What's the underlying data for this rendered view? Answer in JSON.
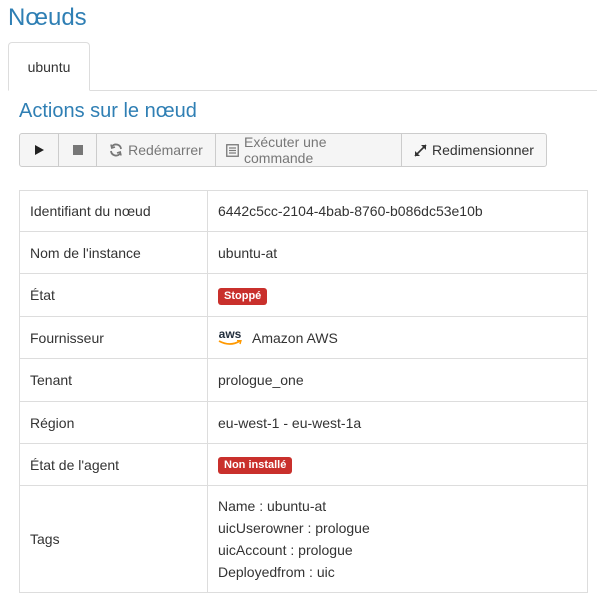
{
  "page": {
    "title": "Nœuds"
  },
  "tabs": [
    {
      "label": "ubuntu"
    }
  ],
  "actions": {
    "title": "Actions sur le nœud",
    "restart_label": "Redémarrer",
    "exec_label": "Exécuter une commande",
    "resize_label": "Redimensionner"
  },
  "details": {
    "id_key": "Identifiant du nœud",
    "id_value": "6442c5cc-2104-4bab-8760-b086dc53e10b",
    "instance_key": "Nom de l'instance",
    "instance_value": "ubuntu-at",
    "state_key": "État",
    "state_value": "Stoppé",
    "provider_key": "Fournisseur",
    "provider_logo_text": "aws",
    "provider_value": "Amazon AWS",
    "tenant_key": "Tenant",
    "tenant_value": "prologue_one",
    "region_key": "Région",
    "region_value": "eu-west-1 - eu-west-1a",
    "agent_key": "État de l'agent",
    "agent_value": "Non installé",
    "tags_key": "Tags",
    "tags": [
      "Name : ubuntu-at",
      "uicUserowner : prologue",
      "uicAccount : prologue",
      "Deployedfrom : uic"
    ]
  },
  "colors": {
    "title": "#2f7fb4",
    "badge_danger": "#c9302c",
    "aws_orange": "#f90"
  },
  "icons": {
    "play": "play-icon",
    "stop": "stop-icon",
    "restart": "refresh-icon",
    "exec": "terminal-icon",
    "resize": "resize-icon"
  }
}
